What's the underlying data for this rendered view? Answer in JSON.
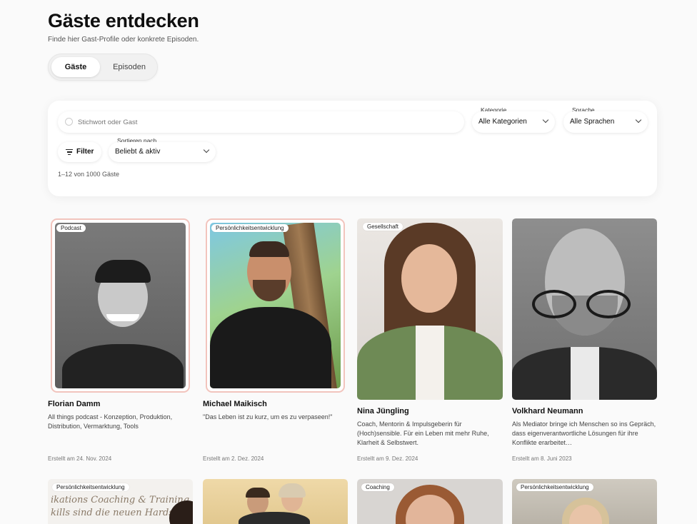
{
  "page": {
    "title": "Gäste entdecken",
    "subtitle": "Finde hier Gast-Profile oder konkrete Episoden."
  },
  "tabs": [
    {
      "label": "Gäste",
      "active": true
    },
    {
      "label": "Episoden",
      "active": false
    }
  ],
  "filters": {
    "search_placeholder": "Stichwort oder Gast",
    "search_value": "",
    "category_label": "Kategorie",
    "category_value": "Alle Kategorien",
    "language_label": "Sprache",
    "language_value": "Alle Sprachen",
    "filter_button": "Filter",
    "sort_label": "Sortieren nach",
    "sort_value": "Beliebt & aktiv",
    "result_count": "1–12 von 1000 Gäste"
  },
  "guests": [
    {
      "name": "Florian Damm",
      "category": "Podcast",
      "description": "All things podcast - Konzeption, Produktion, Distribution, Vermarktung, Tools",
      "created": "Erstellt am 24. Nov. 2024",
      "highlighted": true
    },
    {
      "name": "Michael Maikisch",
      "category": "Persönlichkeitsentwicklung",
      "description": "\"Das Leben ist zu kurz, um es zu verpaseen!\"",
      "created": "Erstellt am 2. Dez. 2024",
      "highlighted": true
    },
    {
      "name": "Nina Jüngling",
      "category": "Gesellschaft",
      "description": "Coach, Mentorin & Impulsgeberin für (Hoch)sensible. Für ein Leben mit mehr Ruhe, Klarheit & Selbstwert.",
      "created": "Erstellt am 9. Dez. 2024",
      "highlighted": false
    },
    {
      "name": "Volkhard Neumann",
      "category": "",
      "description": "Als Mediator bringe ich Menschen so ins Gepräch, dass eigenverantwortliche Lösungen für ihre Konflikte erarbeitet…",
      "created": "Erstellt am 8. Juni 2023",
      "highlighted": false
    }
  ],
  "guests_row2": [
    {
      "category": "Persönlichkeitsentwicklung",
      "image_text_1": "ikations Coaching & Training",
      "image_text_2": "kills sind die neuen Hardskills"
    },
    {
      "category": ""
    },
    {
      "category": "Coaching"
    },
    {
      "category": "Persönlichkeitsentwicklung"
    }
  ],
  "colors": {
    "background": "#fafafa",
    "highlight_border": "#f2c4bd"
  },
  "icons": {
    "search": "search-icon",
    "filter": "filter-icon",
    "dropdown": "chevron-down-icon"
  }
}
